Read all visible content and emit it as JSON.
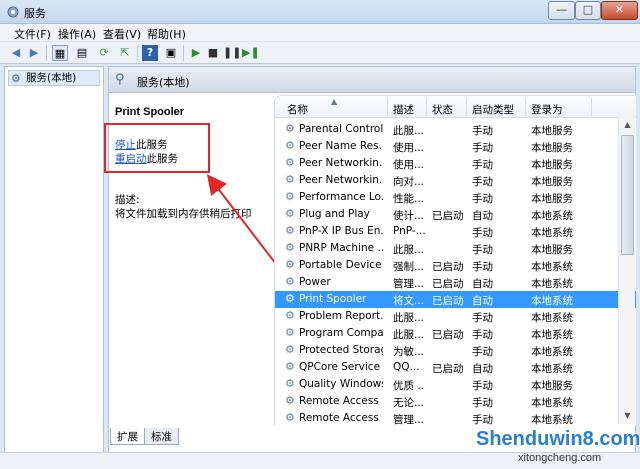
{
  "window": {
    "title": "服务",
    "min_symbol": "—",
    "max_symbol": "□",
    "close_symbol": "✕"
  },
  "menu": [
    "文件(F)",
    "操作(A)",
    "查看(V)",
    "帮助(H)"
  ],
  "toolbar": {
    "icons": [
      "back-icon",
      "forward-icon",
      "show-tree-icon",
      "properties-icon",
      "refresh-icon",
      "export-icon",
      "help-icon",
      "console-icon",
      "play-icon",
      "stop-icon",
      "pause-icon",
      "restart-icon"
    ]
  },
  "tree": {
    "item": "服务(本地)"
  },
  "panel": {
    "header": "服务(本地)",
    "selected_service": "Print Spooler",
    "stop_link": "停止",
    "stop_suffix": "此服务",
    "restart_link": "重启动",
    "restart_suffix": "此服务",
    "desc_label": "描述:",
    "desc_text": "将文件加载到内存供稍后打印"
  },
  "columns": {
    "name": "名称",
    "desc": "描述",
    "status": "状态",
    "startup": "启动类型",
    "login": "登录为"
  },
  "rows": [
    {
      "name": "Parental Controls",
      "desc": "此服...",
      "status": "",
      "startup": "手动",
      "login": "本地服务"
    },
    {
      "name": "Peer Name Res...",
      "desc": "使用...",
      "status": "",
      "startup": "手动",
      "login": "本地服务"
    },
    {
      "name": "Peer Networkin...",
      "desc": "使用...",
      "status": "",
      "startup": "手动",
      "login": "本地服务"
    },
    {
      "name": "Peer Networkin...",
      "desc": "向对...",
      "status": "",
      "startup": "手动",
      "login": "本地服务"
    },
    {
      "name": "Performance Lo...",
      "desc": "性能...",
      "status": "",
      "startup": "手动",
      "login": "本地服务"
    },
    {
      "name": "Plug and Play",
      "desc": "使计...",
      "status": "已启动",
      "startup": "自动",
      "login": "本地系统"
    },
    {
      "name": "PnP-X IP Bus En...",
      "desc": "PnP-...",
      "status": "",
      "startup": "手动",
      "login": "本地系统"
    },
    {
      "name": "PNRP Machine ...",
      "desc": "此服...",
      "status": "",
      "startup": "手动",
      "login": "本地服务"
    },
    {
      "name": "Portable Device ...",
      "desc": "强制...",
      "status": "已启动",
      "startup": "手动",
      "login": "本地系统"
    },
    {
      "name": "Power",
      "desc": "管理...",
      "status": "已启动",
      "startup": "自动",
      "login": "本地系统"
    },
    {
      "name": "Print Spooler",
      "desc": "将文...",
      "status": "已启动",
      "startup": "自动",
      "login": "本地系统",
      "selected": true
    },
    {
      "name": "Problem Report...",
      "desc": "此服...",
      "status": "",
      "startup": "手动",
      "login": "本地系统"
    },
    {
      "name": "Program Compa...",
      "desc": "此服...",
      "status": "已启动",
      "startup": "手动",
      "login": "本地系统"
    },
    {
      "name": "Protected Storage",
      "desc": "为敏...",
      "status": "",
      "startup": "手动",
      "login": "本地系统"
    },
    {
      "name": "QPCore Service",
      "desc": "QQ...",
      "status": "已启动",
      "startup": "自动",
      "login": "本地系统"
    },
    {
      "name": "Quality Windows...",
      "desc": "优质 ...",
      "status": "",
      "startup": "手动",
      "login": "本地服务"
    },
    {
      "name": "Remote Access ...",
      "desc": "无论...",
      "status": "",
      "startup": "手动",
      "login": "本地系统"
    },
    {
      "name": "Remote Access ...",
      "desc": "管理...",
      "status": "",
      "startup": "手动",
      "login": "本地系统"
    }
  ],
  "tabs": [
    "扩展",
    "标准"
  ],
  "watermark": {
    "text": "Shenduwin8.com",
    "sub": "xitongcheng.com"
  },
  "colors": {
    "selection": "#3399ff",
    "link": "#1a58c4",
    "annotation": "#e0262a"
  }
}
